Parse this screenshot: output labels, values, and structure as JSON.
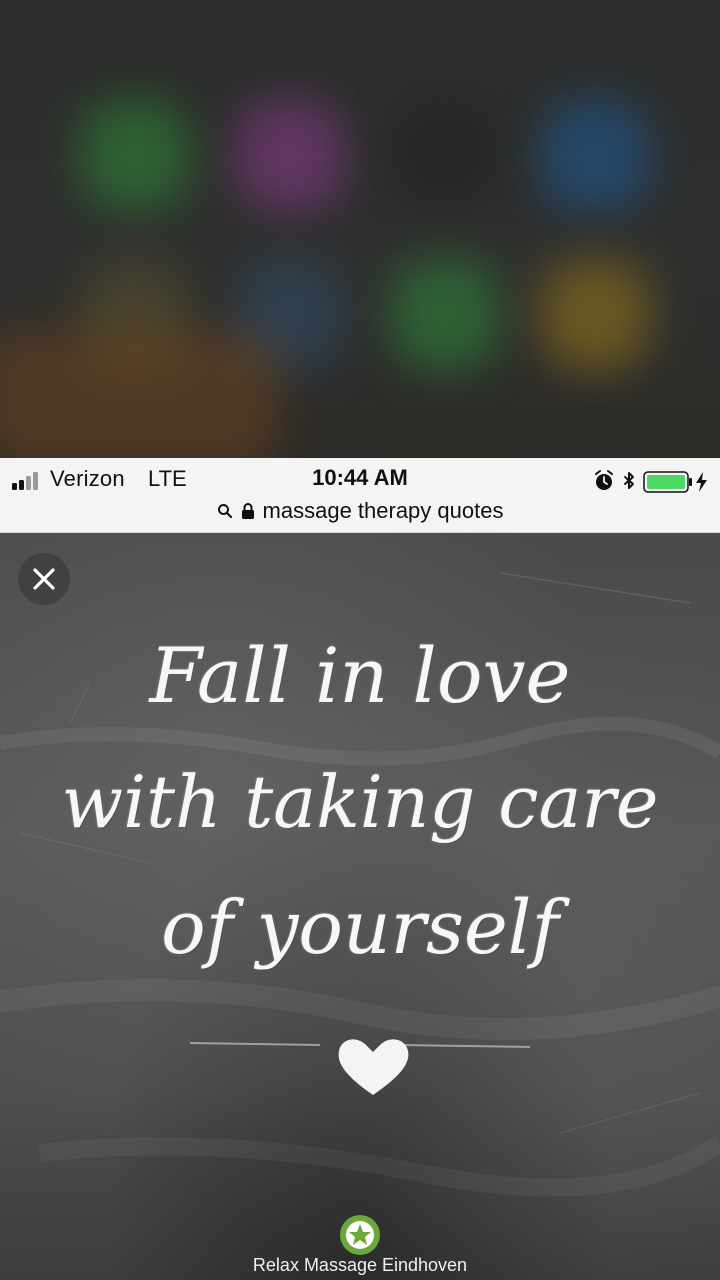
{
  "status_bar": {
    "carrier": "Verizon",
    "network": "LTE",
    "time": "10:44 AM",
    "battery_color": "#4cd964"
  },
  "url_bar": {
    "text": "massage therapy quotes"
  },
  "image": {
    "quote_line_1": "Fall in love",
    "quote_line_2": "with taking care",
    "quote_line_3": "of yourself",
    "brand": "Relax Massage Eindhoven"
  },
  "colors": {
    "status_bg": "#f4f4f4",
    "chalk_text": "#f7f7f7",
    "logo_green": "#6aa83a"
  },
  "icons": {
    "close": "close-icon",
    "search": "search-icon",
    "lock": "lock-icon",
    "alarm": "alarm-icon",
    "bluetooth": "bluetooth-icon",
    "battery": "battery-icon",
    "charging": "charging-bolt-icon",
    "heart": "heart-icon",
    "logo": "lotus-logo-icon"
  }
}
